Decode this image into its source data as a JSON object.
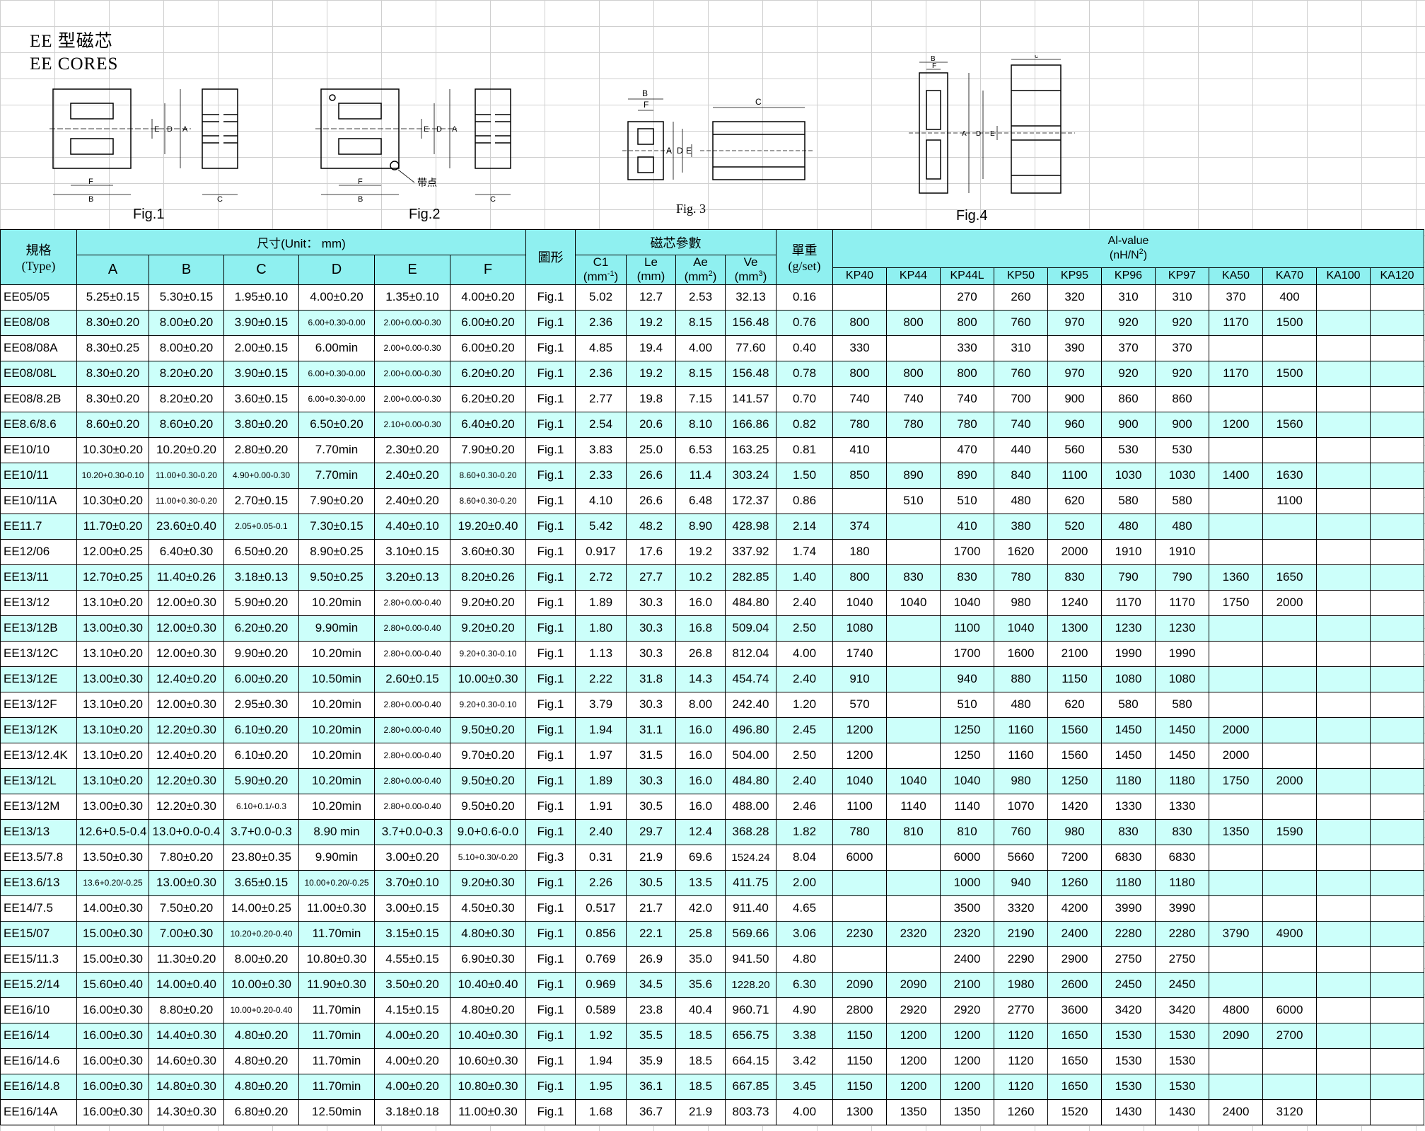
{
  "title_cn": "EE 型磁芯",
  "title_en": "EE CORES",
  "figures": {
    "fig1": "Fig.1",
    "fig2": "Fig.2",
    "fig3": "Fig. 3",
    "fig4": "Fig.4",
    "mark_note": "带点"
  },
  "header": {
    "type_cn": "規格",
    "type_en": "(Type)",
    "dims_group": "尺寸(Unit： mm)",
    "dims": [
      "A",
      "B",
      "C",
      "D",
      "E",
      "F"
    ],
    "shape": "圖形",
    "params_group": "磁芯參數",
    "c1": "C1",
    "c1_unit": "(mm",
    "c1_exp": "-1",
    "c1_close": ")",
    "le": "Le",
    "le_unit": "(mm)",
    "ae": "Ae",
    "ae_unit": "(mm",
    "ae_exp": "2",
    "ae_close": ")",
    "ve": "Ve",
    "ve_unit": "(mm",
    "ve_exp": "3",
    "ve_close": ")",
    "weight_cn": "單重",
    "weight_unit": "(g/set)",
    "al_title": "Al-value",
    "al_unit": "(nH/N",
    "al_exp": "2",
    "al_close": ")",
    "materials": [
      "KP40",
      "KP44",
      "KP44L",
      "KP50",
      "KP95",
      "KP96",
      "KP97",
      "KA50",
      "KA70",
      "KA100",
      "KA120"
    ]
  },
  "rows": [
    [
      "EE05/05",
      "5.25±0.15",
      "5.30±0.15",
      "1.95±0.10",
      "4.00±0.20",
      "1.35±0.10",
      "4.00±0.20",
      "Fig.1",
      "5.02",
      "12.7",
      "2.53",
      "32.13",
      "0.16",
      "",
      "",
      "270",
      "260",
      "320",
      "310",
      "310",
      "370",
      "400",
      "",
      ""
    ],
    [
      "EE08/08",
      "8.30±0.20",
      "8.00±0.20",
      "3.90±0.15",
      "6.00+0.30-0.00",
      "2.00+0.00-0.30",
      "6.00±0.20",
      "Fig.1",
      "2.36",
      "19.2",
      "8.15",
      "156.48",
      "0.76",
      "800",
      "800",
      "800",
      "760",
      "970",
      "920",
      "920",
      "1170",
      "1500",
      "",
      ""
    ],
    [
      "EE08/08A",
      "8.30±0.25",
      "8.00±0.20",
      "2.00±0.15",
      "6.00min",
      "2.00+0.00-0.30",
      "6.00±0.20",
      "Fig.1",
      "4.85",
      "19.4",
      "4.00",
      "77.60",
      "0.40",
      "330",
      "",
      "330",
      "310",
      "390",
      "370",
      "370",
      "",
      "",
      "",
      ""
    ],
    [
      "EE08/08L",
      "8.30±0.20",
      "8.20±0.20",
      "3.90±0.15",
      "6.00+0.30-0.00",
      "2.00+0.00-0.30",
      "6.20±0.20",
      "Fig.1",
      "2.36",
      "19.2",
      "8.15",
      "156.48",
      "0.78",
      "800",
      "800",
      "800",
      "760",
      "970",
      "920",
      "920",
      "1170",
      "1500",
      "",
      ""
    ],
    [
      "EE08/8.2B",
      "8.30±0.20",
      "8.20±0.20",
      "3.60±0.15",
      "6.00+0.30-0.00",
      "2.00+0.00-0.30",
      "6.20±0.20",
      "Fig.1",
      "2.77",
      "19.8",
      "7.15",
      "141.57",
      "0.70",
      "740",
      "740",
      "740",
      "700",
      "900",
      "860",
      "860",
      "",
      "",
      "",
      ""
    ],
    [
      "EE8.6/8.6",
      "8.60±0.20",
      "8.60±0.20",
      "3.80±0.20",
      "6.50±0.20",
      "2.10+0.00-0.30",
      "6.40±0.20",
      "Fig.1",
      "2.54",
      "20.6",
      "8.10",
      "166.86",
      "0.82",
      "780",
      "780",
      "780",
      "740",
      "960",
      "900",
      "900",
      "1200",
      "1560",
      "",
      ""
    ],
    [
      "EE10/10",
      "10.30±0.20",
      "10.20±0.20",
      "2.80±0.20",
      "7.70min",
      "2.30±0.20",
      "7.90±0.20",
      "Fig.1",
      "3.83",
      "25.0",
      "6.53",
      "163.25",
      "0.81",
      "410",
      "",
      "470",
      "440",
      "560",
      "530",
      "530",
      "",
      "",
      "",
      ""
    ],
    [
      "EE10/11",
      "10.20+0.30-0.10",
      "11.00+0.30-0.20",
      "4.90+0.00-0.30",
      "7.70min",
      "2.40±0.20",
      "8.60+0.30-0.20",
      "Fig.1",
      "2.33",
      "26.6",
      "11.4",
      "303.24",
      "1.50",
      "850",
      "890",
      "890",
      "840",
      "1100",
      "1030",
      "1030",
      "1400",
      "1630",
      "",
      ""
    ],
    [
      "EE10/11A",
      "10.30±0.20",
      "11.00+0.30-0.20",
      "2.70±0.15",
      "7.90±0.20",
      "2.40±0.20",
      "8.60+0.30-0.20",
      "Fig.1",
      "4.10",
      "26.6",
      "6.48",
      "172.37",
      "0.86",
      "",
      "510",
      "510",
      "480",
      "620",
      "580",
      "580",
      "",
      "1100",
      "",
      ""
    ],
    [
      "EE11.7",
      "11.70±0.20",
      "23.60±0.40",
      "2.05+0.05-0.1",
      "7.30±0.15",
      "4.40±0.10",
      "19.20±0.40",
      "Fig.1",
      "5.42",
      "48.2",
      "8.90",
      "428.98",
      "2.14",
      "374",
      "",
      "410",
      "380",
      "520",
      "480",
      "480",
      "",
      "",
      "",
      ""
    ],
    [
      "EE12/06",
      "12.00±0.25",
      "6.40±0.30",
      "6.50±0.20",
      "8.90±0.25",
      "3.10±0.15",
      "3.60±0.30",
      "Fig.1",
      "0.917",
      "17.6",
      "19.2",
      "337.92",
      "1.74",
      "180",
      "",
      "1700",
      "1620",
      "2000",
      "1910",
      "1910",
      "",
      "",
      "",
      ""
    ],
    [
      "EE13/11",
      "12.70±0.25",
      "11.40±0.26",
      "3.18±0.13",
      "9.50±0.25",
      "3.20±0.13",
      "8.20±0.26",
      "Fig.1",
      "2.72",
      "27.7",
      "10.2",
      "282.85",
      "1.40",
      "800",
      "830",
      "830",
      "780",
      "830",
      "790",
      "790",
      "1360",
      "1650",
      "",
      ""
    ],
    [
      "EE13/12",
      "13.10±0.20",
      "12.00±0.30",
      "5.90±0.20",
      "10.20min",
      "2.80+0.00-0.40",
      "9.20±0.20",
      "Fig.1",
      "1.89",
      "30.3",
      "16.0",
      "484.80",
      "2.40",
      "1040",
      "1040",
      "1040",
      "980",
      "1240",
      "1170",
      "1170",
      "1750",
      "2000",
      "",
      ""
    ],
    [
      "EE13/12B",
      "13.00±0.30",
      "12.00±0.30",
      "6.20±0.20",
      "9.90min",
      "2.80+0.00-0.40",
      "9.20±0.20",
      "Fig.1",
      "1.80",
      "30.3",
      "16.8",
      "509.04",
      "2.50",
      "1080",
      "",
      "1100",
      "1040",
      "1300",
      "1230",
      "1230",
      "",
      "",
      "",
      ""
    ],
    [
      "EE13/12C",
      "13.10±0.20",
      "12.00±0.30",
      "9.90±0.20",
      "10.20min",
      "2.80+0.00-0.40",
      "9.20+0.30-0.10",
      "Fig.1",
      "1.13",
      "30.3",
      "26.8",
      "812.04",
      "4.00",
      "1740",
      "",
      "1700",
      "1600",
      "2100",
      "1990",
      "1990",
      "",
      "",
      "",
      ""
    ],
    [
      "EE13/12E",
      "13.00±0.30",
      "12.40±0.20",
      "6.00±0.20",
      "10.50min",
      "2.60±0.15",
      "10.00±0.30",
      "Fig.1",
      "2.22",
      "31.8",
      "14.3",
      "454.74",
      "2.40",
      "910",
      "",
      "940",
      "880",
      "1150",
      "1080",
      "1080",
      "",
      "",
      "",
      ""
    ],
    [
      "EE13/12F",
      "13.10±0.20",
      "12.00±0.30",
      "2.95±0.30",
      "10.20min",
      "2.80+0.00-0.40",
      "9.20+0.30-0.10",
      "Fig.1",
      "3.79",
      "30.3",
      "8.00",
      "242.40",
      "1.20",
      "570",
      "",
      "510",
      "480",
      "620",
      "580",
      "580",
      "",
      "",
      "",
      ""
    ],
    [
      "EE13/12K",
      "13.10±0.20",
      "12.20±0.30",
      "6.10±0.20",
      "10.20min",
      "2.80+0.00-0.40",
      "9.50±0.20",
      "Fig.1",
      "1.94",
      "31.1",
      "16.0",
      "496.80",
      "2.45",
      "1200",
      "",
      "1250",
      "1160",
      "1560",
      "1450",
      "1450",
      "2000",
      "",
      "",
      ""
    ],
    [
      "EE13/12.4K",
      "13.10±0.20",
      "12.40±0.20",
      "6.10±0.20",
      "10.20min",
      "2.80+0.00-0.40",
      "9.70±0.20",
      "Fig.1",
      "1.97",
      "31.5",
      "16.0",
      "504.00",
      "2.50",
      "1200",
      "",
      "1250",
      "1160",
      "1560",
      "1450",
      "1450",
      "2000",
      "",
      "",
      ""
    ],
    [
      "EE13/12L",
      "13.10±0.20",
      "12.20±0.30",
      "5.90±0.20",
      "10.20min",
      "2.80+0.00-0.40",
      "9.50±0.20",
      "Fig.1",
      "1.89",
      "30.3",
      "16.0",
      "484.80",
      "2.40",
      "1040",
      "1040",
      "1040",
      "980",
      "1250",
      "1180",
      "1180",
      "1750",
      "2000",
      "",
      ""
    ],
    [
      "EE13/12M",
      "13.00±0.30",
      "12.20±0.30",
      "6.10+0.1/-0.3",
      "10.20min",
      "2.80+0.00-0.40",
      "9.50±0.20",
      "Fig.1",
      "1.91",
      "30.5",
      "16.0",
      "488.00",
      "2.46",
      "1100",
      "1140",
      "1140",
      "1070",
      "1420",
      "1330",
      "1330",
      "",
      "",
      "",
      ""
    ],
    [
      "EE13/13",
      "12.6+0.5-0.4",
      "13.0+0.0-0.4",
      "3.7+0.0-0.3",
      "8.90 min",
      "3.7+0.0-0.3",
      "9.0+0.6-0.0",
      "Fig.1",
      "2.40",
      "29.7",
      "12.4",
      "368.28",
      "1.82",
      "780",
      "810",
      "810",
      "760",
      "980",
      "830",
      "830",
      "1350",
      "1590",
      "",
      ""
    ],
    [
      "EE13.5/7.8",
      "13.50±0.30",
      "7.80±0.20",
      "23.80±0.35",
      "9.90min",
      "3.00±0.20",
      "5.10+0.30/-0.20",
      "Fig.3",
      "0.31",
      "21.9",
      "69.6",
      "1524.24",
      "8.04",
      "6000",
      "",
      "6000",
      "5660",
      "7200",
      "6830",
      "6830",
      "",
      "",
      "",
      ""
    ],
    [
      "EE13.6/13",
      "13.6+0.20/-0.25",
      "13.00±0.30",
      "3.65±0.15",
      "10.00+0.20/-0.25",
      "3.70±0.10",
      "9.20±0.30",
      "Fig.1",
      "2.26",
      "30.5",
      "13.5",
      "411.75",
      "2.00",
      "",
      "",
      "1000",
      "940",
      "1260",
      "1180",
      "1180",
      "",
      "",
      "",
      ""
    ],
    [
      "EE14/7.5",
      "14.00±0.30",
      "7.50±0.20",
      "14.00±0.25",
      "11.00±0.30",
      "3.00±0.15",
      "4.50±0.30",
      "Fig.1",
      "0.517",
      "21.7",
      "42.0",
      "911.40",
      "4.65",
      "",
      "",
      "3500",
      "3320",
      "4200",
      "3990",
      "3990",
      "",
      "",
      "",
      ""
    ],
    [
      "EE15/07",
      "15.00±0.30",
      "7.00±0.30",
      "10.20+0.20-0.40",
      "11.70min",
      "3.15±0.15",
      "4.80±0.30",
      "Fig.1",
      "0.856",
      "22.1",
      "25.8",
      "569.66",
      "3.06",
      "2230",
      "2320",
      "2320",
      "2190",
      "2400",
      "2280",
      "2280",
      "3790",
      "4900",
      "",
      ""
    ],
    [
      "EE15/11.3",
      "15.00±0.30",
      "11.30±0.20",
      "8.00±0.20",
      "10.80±0.30",
      "4.55±0.15",
      "6.90±0.30",
      "Fig.1",
      "0.769",
      "26.9",
      "35.0",
      "941.50",
      "4.80",
      "",
      "",
      "2400",
      "2290",
      "2900",
      "2750",
      "2750",
      "",
      "",
      "",
      ""
    ],
    [
      "EE15.2/14",
      "15.60±0.40",
      "14.00±0.40",
      "10.00±0.30",
      "11.90±0.30",
      "3.50±0.20",
      "10.40±0.40",
      "Fig.1",
      "0.969",
      "34.5",
      "35.6",
      "1228.20",
      "6.30",
      "2090",
      "2090",
      "2100",
      "1980",
      "2600",
      "2450",
      "2450",
      "",
      "",
      "",
      ""
    ],
    [
      "EE16/10",
      "16.00±0.30",
      "8.80±0.20",
      "10.00+0.20-0.40",
      "11.70min",
      "4.15±0.15",
      "4.80±0.20",
      "Fig.1",
      "0.589",
      "23.8",
      "40.4",
      "960.71",
      "4.90",
      "2800",
      "2920",
      "2920",
      "2770",
      "3600",
      "3420",
      "3420",
      "4800",
      "6000",
      "",
      ""
    ],
    [
      "EE16/14",
      "16.00±0.30",
      "14.40±0.30",
      "4.80±0.20",
      "11.70min",
      "4.00±0.20",
      "10.40±0.30",
      "Fig.1",
      "1.92",
      "35.5",
      "18.5",
      "656.75",
      "3.38",
      "1150",
      "1200",
      "1200",
      "1120",
      "1650",
      "1530",
      "1530",
      "2090",
      "2700",
      "",
      ""
    ],
    [
      "EE16/14.6",
      "16.00±0.30",
      "14.60±0.30",
      "4.80±0.20",
      "11.70min",
      "4.00±0.20",
      "10.60±0.30",
      "Fig.1",
      "1.94",
      "35.9",
      "18.5",
      "664.15",
      "3.42",
      "1150",
      "1200",
      "1200",
      "1120",
      "1650",
      "1530",
      "1530",
      "",
      "",
      "",
      ""
    ],
    [
      "EE16/14.8",
      "16.00±0.30",
      "14.80±0.30",
      "4.80±0.20",
      "11.70min",
      "4.00±0.20",
      "10.80±0.30",
      "Fig.1",
      "1.95",
      "36.1",
      "18.5",
      "667.85",
      "3.45",
      "1150",
      "1200",
      "1200",
      "1120",
      "1650",
      "1530",
      "1530",
      "",
      "",
      "",
      ""
    ],
    [
      "EE16/14A",
      "16.00±0.30",
      "14.30±0.30",
      "6.80±0.20",
      "12.50min",
      "3.18±0.18",
      "11.00±0.30",
      "Fig.1",
      "1.68",
      "36.7",
      "21.9",
      "803.73",
      "4.00",
      "1300",
      "1350",
      "1350",
      "1260",
      "1520",
      "1430",
      "1430",
      "2400",
      "3120",
      "",
      ""
    ]
  ]
}
